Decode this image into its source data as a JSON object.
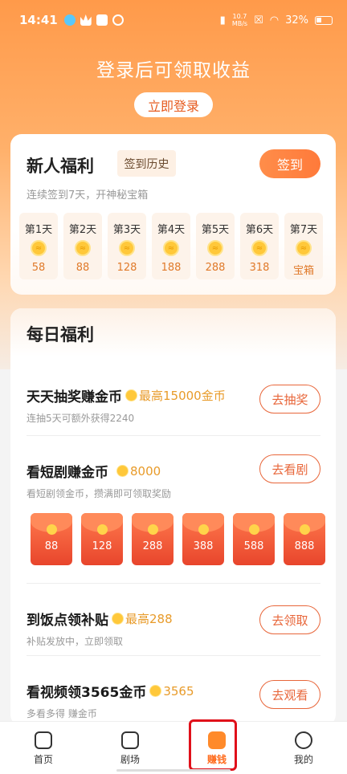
{
  "status": {
    "time": "14:41",
    "net_speed_top": "10.7",
    "net_speed_bottom": "MB/s",
    "battery": "32%"
  },
  "hero": {
    "title": "登录后可领取收益",
    "login_button": "立即登录"
  },
  "newbie": {
    "title": "新人福利",
    "history": "签到历史",
    "sign_button": "签到",
    "subtitle": "连续签到7天，开神秘宝箱",
    "days": [
      {
        "label": "第1天",
        "value": "58"
      },
      {
        "label": "第2天",
        "value": "88"
      },
      {
        "label": "第3天",
        "value": "128"
      },
      {
        "label": "第4天",
        "value": "188"
      },
      {
        "label": "第5天",
        "value": "288"
      },
      {
        "label": "第6天",
        "value": "318"
      },
      {
        "label": "第7天",
        "value": "宝箱"
      }
    ]
  },
  "daily": {
    "title": "每日福利",
    "tasks": [
      {
        "title": "天天抽奖赚金币",
        "extra": "最高15000金币",
        "sub": "连抽5天可额外获得2240",
        "button": "去抽奖"
      },
      {
        "title": "看短剧赚金币",
        "extra": "8000",
        "sub": "看短剧领金币，攒满即可领取奖励",
        "button": "去看剧"
      },
      {
        "title": "到饭点领补贴",
        "extra": "最高288",
        "sub": "补贴发放中，立即领取",
        "button": "去领取"
      },
      {
        "title": "看视频领3565金币",
        "extra": "3565",
        "sub": "多看多得 赚金币",
        "button": "去观看"
      }
    ],
    "packets": [
      "88",
      "128",
      "288",
      "388",
      "588",
      "888"
    ]
  },
  "tabbar": {
    "tabs": [
      {
        "label": "首页"
      },
      {
        "label": "剧场"
      },
      {
        "label": "赚钱"
      },
      {
        "label": "我的"
      }
    ]
  }
}
